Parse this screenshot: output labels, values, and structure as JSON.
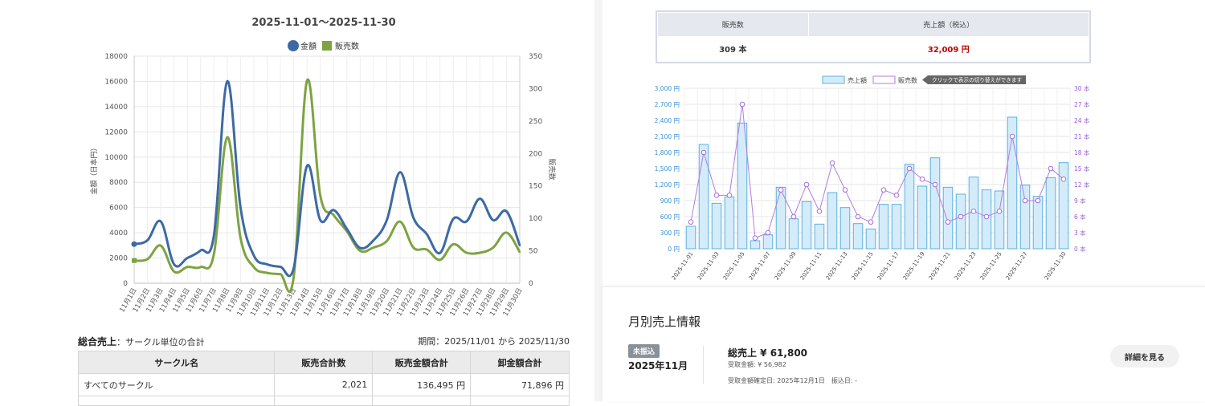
{
  "left_chart": {
    "title": "2025-11-01～2025-11-30",
    "legend": [
      {
        "name": "金額",
        "color": "#3d6aa5"
      },
      {
        "name": "販売数",
        "color": "#7ea342"
      }
    ],
    "y_left_label": "金額（日本円）",
    "y_right_label": "販売数",
    "y_left_ticks": [
      "0",
      "2000",
      "4000",
      "6000",
      "8000",
      "10000",
      "12000",
      "14000",
      "16000",
      "18000"
    ],
    "y_right_ticks": [
      "0",
      "50",
      "100",
      "150",
      "200",
      "250",
      "300",
      "350"
    ],
    "x_labels": [
      "11月1日",
      "11月2日",
      "11月3日",
      "11月4日",
      "11月5日",
      "11月6日",
      "11月7日",
      "11月8日",
      "11月9日",
      "11月10日",
      "11月11日",
      "11月12日",
      "11月13日",
      "11月14日",
      "11月15日",
      "11月16日",
      "11月17日",
      "11月18日",
      "11月19日",
      "11月20日",
      "11月21日",
      "11月22日",
      "11月23日",
      "11月24日",
      "11月25日",
      "11月26日",
      "11月27日",
      "11月28日",
      "11月29日",
      "11月30日"
    ]
  },
  "summary": {
    "title": "総合売上",
    "subtitle": "：サークル単位の合計",
    "period": "期間：2025/11/01 から 2025/11/30",
    "headers": [
      "サークル名",
      "販売合計数",
      "販売金額合計",
      "卸金額合計"
    ],
    "rows": [
      [
        "すべてのサークル",
        "2,021",
        "136,495 円",
        "71,896 円"
      ]
    ]
  },
  "totals": {
    "headers": [
      "販売数",
      "売上額（税込）"
    ],
    "values": [
      "309 本",
      "32,009 円"
    ]
  },
  "right_chart": {
    "legend_amount": "売上額",
    "legend_count": "販売数",
    "legend_note": "クリックで表示の切り替えができます",
    "y_left_ticks": [
      "0 円",
      "300 円",
      "600 円",
      "900 円",
      "1,200 円",
      "1,500 円",
      "1,800 円",
      "2,100 円",
      "2,400 円",
      "2,700 円",
      "3,000 円"
    ],
    "y_right_ticks": [
      "0 本",
      "3 本",
      "6 本",
      "9 本",
      "12 本",
      "15 本",
      "18 本",
      "21 本",
      "24 本",
      "27 本",
      "30 本"
    ],
    "x_labels": [
      "2025-11-01",
      "2025-11-03",
      "2025-11-05",
      "2025-11-07",
      "2025-11-09",
      "2025-11-11",
      "2025-11-13",
      "2025-11-15",
      "2025-11-17",
      "2025-11-19",
      "2025-11-21",
      "2025-11-23",
      "2025-11-25",
      "2025-11-27",
      "2025-11-30"
    ]
  },
  "chart_data": [
    {
      "type": "line",
      "title": "2025-11-01～2025-11-30",
      "xlabel": "",
      "ylabel": "金額（日本円）",
      "y2label": "販売数",
      "categories": [
        "11月1日",
        "11月2日",
        "11月3日",
        "11月4日",
        "11月5日",
        "11月6日",
        "11月7日",
        "11月8日",
        "11月9日",
        "11月10日",
        "11月11日",
        "11月12日",
        "11月13日",
        "11月14日",
        "11月15日",
        "11月16日",
        "11月17日",
        "11月18日",
        "11月19日",
        "11月20日",
        "11月21日",
        "11月22日",
        "11月23日",
        "11月24日",
        "11月25日",
        "11月26日",
        "11月27日",
        "11月28日",
        "11月29日",
        "11月30日"
      ],
      "ylim": [
        0,
        18000
      ],
      "y2lim": [
        0,
        350
      ],
      "series": [
        {
          "name": "金額",
          "axis": "left",
          "values": [
            3100,
            3400,
            4900,
            1500,
            2000,
            2600,
            3800,
            16000,
            6000,
            2200,
            1500,
            1300,
            1200,
            9300,
            5000,
            5800,
            4300,
            2800,
            3400,
            5000,
            8800,
            5200,
            3900,
            2400,
            5100,
            4900,
            6700,
            5000,
            5700,
            3000
          ]
        },
        {
          "name": "販売数",
          "axis": "right",
          "values": [
            35,
            37,
            58,
            18,
            25,
            25,
            45,
            225,
            70,
            25,
            16,
            14,
            10,
            312,
            135,
            105,
            80,
            50,
            55,
            65,
            95,
            55,
            52,
            36,
            60,
            47,
            47,
            55,
            78,
            48
          ]
        }
      ]
    },
    {
      "type": "bar",
      "xlabel": "",
      "ylabel": "",
      "categories": [
        "2025-11-01",
        "2025-11-02",
        "2025-11-03",
        "2025-11-04",
        "2025-11-05",
        "2025-11-06",
        "2025-11-07",
        "2025-11-08",
        "2025-11-09",
        "2025-11-10",
        "2025-11-11",
        "2025-11-12",
        "2025-11-13",
        "2025-11-14",
        "2025-11-15",
        "2025-11-16",
        "2025-11-17",
        "2025-11-18",
        "2025-11-19",
        "2025-11-20",
        "2025-11-21",
        "2025-11-22",
        "2025-11-23",
        "2025-11-24",
        "2025-11-25",
        "2025-11-26",
        "2025-11-27",
        "2025-11-28",
        "2025-11-29",
        "2025-11-30"
      ],
      "ylim": [
        0,
        3000
      ],
      "y2lim": [
        0,
        30
      ],
      "series": [
        {
          "name": "売上額",
          "axis": "left",
          "values": [
            420,
            1950,
            850,
            970,
            2350,
            150,
            260,
            1150,
            560,
            880,
            460,
            1050,
            770,
            470,
            370,
            830,
            830,
            1580,
            1170,
            1700,
            1150,
            1020,
            1340,
            1100,
            1080,
            2460,
            1190,
            980,
            1330,
            1610
          ]
        },
        {
          "name": "販売数",
          "axis": "right",
          "values": [
            5,
            18,
            10,
            10,
            27,
            2,
            3,
            11,
            6,
            12,
            7,
            16,
            11,
            6,
            5,
            11,
            10,
            15,
            13,
            12,
            5,
            6,
            7,
            6,
            7,
            21,
            9,
            9,
            15,
            13
          ]
        }
      ]
    }
  ],
  "monthly": {
    "title": "月別売上情報",
    "badge": "未振込",
    "month": "2025年11月",
    "total": "総売上 ¥ 61,800",
    "received": "受取金額: ¥ 56,982",
    "date_info": "受取金額確定日: 2025年12月1日　振込日: -",
    "detail_button": "詳細を見る"
  }
}
